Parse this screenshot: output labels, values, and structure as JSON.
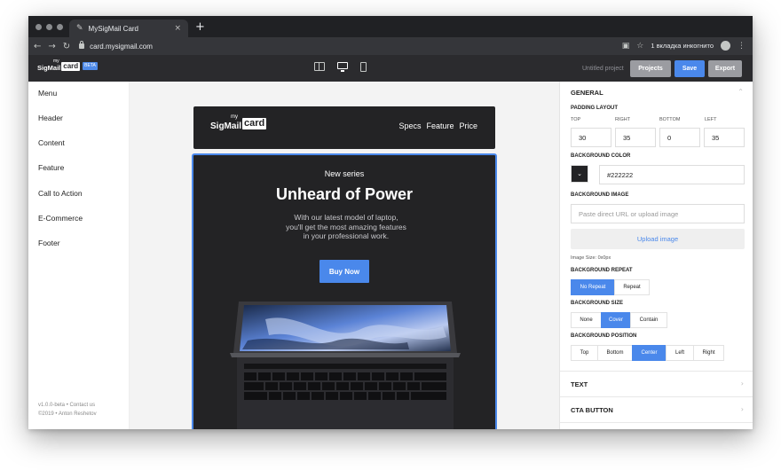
{
  "browser": {
    "tab_title": "MySigMail Card",
    "tab_close": "×",
    "new_tab": "+",
    "url": "card.mysigmail.com",
    "incognito_label": "1 вкладка инкогнито"
  },
  "toolbar": {
    "logo_sig": "SigMail",
    "logo_my": "my",
    "logo_card": "card",
    "logo_beta": "BETA",
    "project_name": "Untitled project",
    "projects_label": "Projects",
    "save_label": "Save",
    "export_label": "Export"
  },
  "sidebar": {
    "items": [
      {
        "label": "Menu"
      },
      {
        "label": "Header"
      },
      {
        "label": "Content"
      },
      {
        "label": "Feature"
      },
      {
        "label": "Call to Action"
      },
      {
        "label": "E-Commerce"
      },
      {
        "label": "Footer"
      }
    ],
    "footer_line1": "v1.0.0-beta • Contact us",
    "footer_line2": "©2019 • Anton Reshetov"
  },
  "preview": {
    "header": {
      "logo_sig": "SigMail",
      "logo_my": "my",
      "logo_card": "card",
      "nav": [
        "Specs",
        "Feature",
        "Price"
      ]
    },
    "hero": {
      "eyebrow": "New series",
      "title": "Unheard of Power",
      "text_line1": "With our latest model of laptop,",
      "text_line2": "you'll get the most amazing features",
      "text_line3": "in your professional work.",
      "cta": "Buy Now"
    }
  },
  "panel": {
    "general_title": "GENERAL",
    "padding_label": "PADDING LAYOUT",
    "padding": [
      {
        "label": "TOP",
        "value": "30"
      },
      {
        "label": "RIGHT",
        "value": "35"
      },
      {
        "label": "BOTTOM",
        "value": "0"
      },
      {
        "label": "LEFT",
        "value": "35"
      }
    ],
    "bg_color_label": "BACKGROUND COLOR",
    "bg_color_value": "#222222",
    "bg_image_label": "BACKGROUND IMAGE",
    "bg_image_placeholder": "Paste direct URL or upload image",
    "upload_label": "Upload image",
    "image_size": "Image Size: 0x0px",
    "bg_repeat_label": "BACKGROUND REPEAT",
    "bg_repeat_options": [
      "No Repeat",
      "Repeat"
    ],
    "bg_size_label": "BACKGROUND SIZE",
    "bg_size_options": [
      "None",
      "Cover",
      "Contain"
    ],
    "bg_position_label": "BACKGROUND POSITION",
    "bg_position_options": [
      "Top",
      "Bottom",
      "Center",
      "Left",
      "Right"
    ],
    "text_section": "TEXT",
    "cta_section": "CTA BUTTON"
  },
  "colors": {
    "accent": "#4a88eb",
    "dark": "#232325"
  }
}
